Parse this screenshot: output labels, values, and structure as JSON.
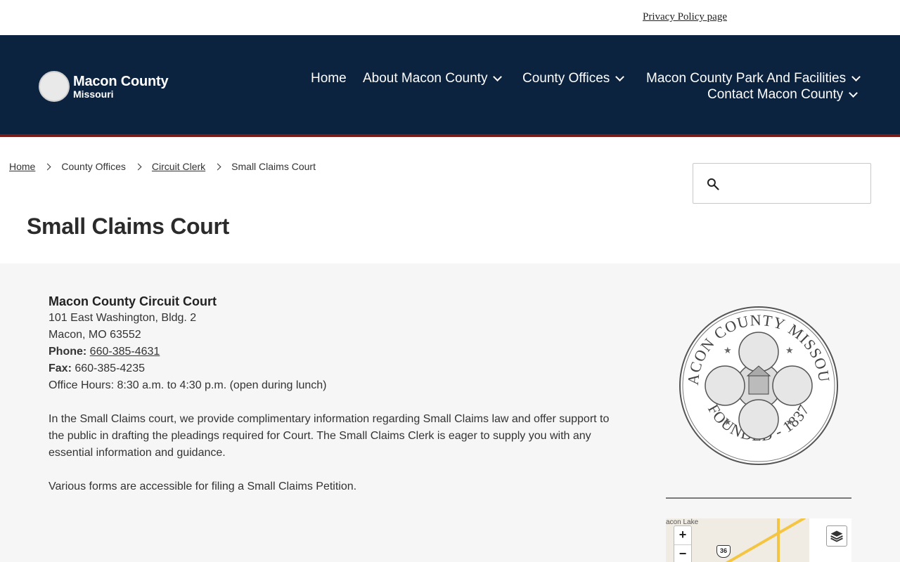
{
  "topbar": {
    "privacy_link": "Privacy Policy page"
  },
  "header": {
    "logo_line1": "Macon County",
    "logo_line2": "Missouri",
    "nav": [
      {
        "label": "Home",
        "has_dropdown": false
      },
      {
        "label": "About Macon County",
        "has_dropdown": true
      },
      {
        "label": "County Offices",
        "has_dropdown": true
      },
      {
        "label": "Macon County Park And Facilities",
        "has_dropdown": true
      },
      {
        "label": "Contact Macon County",
        "has_dropdown": true
      }
    ]
  },
  "breadcrumb": [
    "Home",
    "County Offices",
    "Circuit Clerk",
    "Small Claims Court"
  ],
  "search": {
    "placeholder": "",
    "icon": "search-icon"
  },
  "page_title": "Small Claims Court",
  "contact": {
    "court_name": "Macon County Circuit Court",
    "address1": "101 East Washington, Bldg. 2",
    "address2": "Macon, MO 63552",
    "phone_label": "Phone:",
    "phone": "660-385-4631",
    "fax_label": "Fax:",
    "fax": "660-385-4235",
    "hours": "Office Hours: 8:30 a.m. to 4:30 p.m. (open during lunch)"
  },
  "body": {
    "para1": "In the Small Claims court, we provide complimentary information regarding Small Claims law and offer support to the public in drafting the pleadings required for Court. The Small Claims Clerk is eager to supply you with any essential information and guidance.",
    "para2": "Various forms are accessible for filing a Small Claims Petition."
  },
  "seal": {
    "top_text": "MACON COUNTY MISSOURI",
    "bottom_text": "FOUNDED - 1837"
  },
  "map": {
    "place_label": "acon Lake",
    "route": "36",
    "zoom_in": "+",
    "zoom_out": "−"
  },
  "colors": {
    "header_bg": "#0c2340",
    "accent": "#7a1a16",
    "content_bg": "#f6f6f6"
  }
}
